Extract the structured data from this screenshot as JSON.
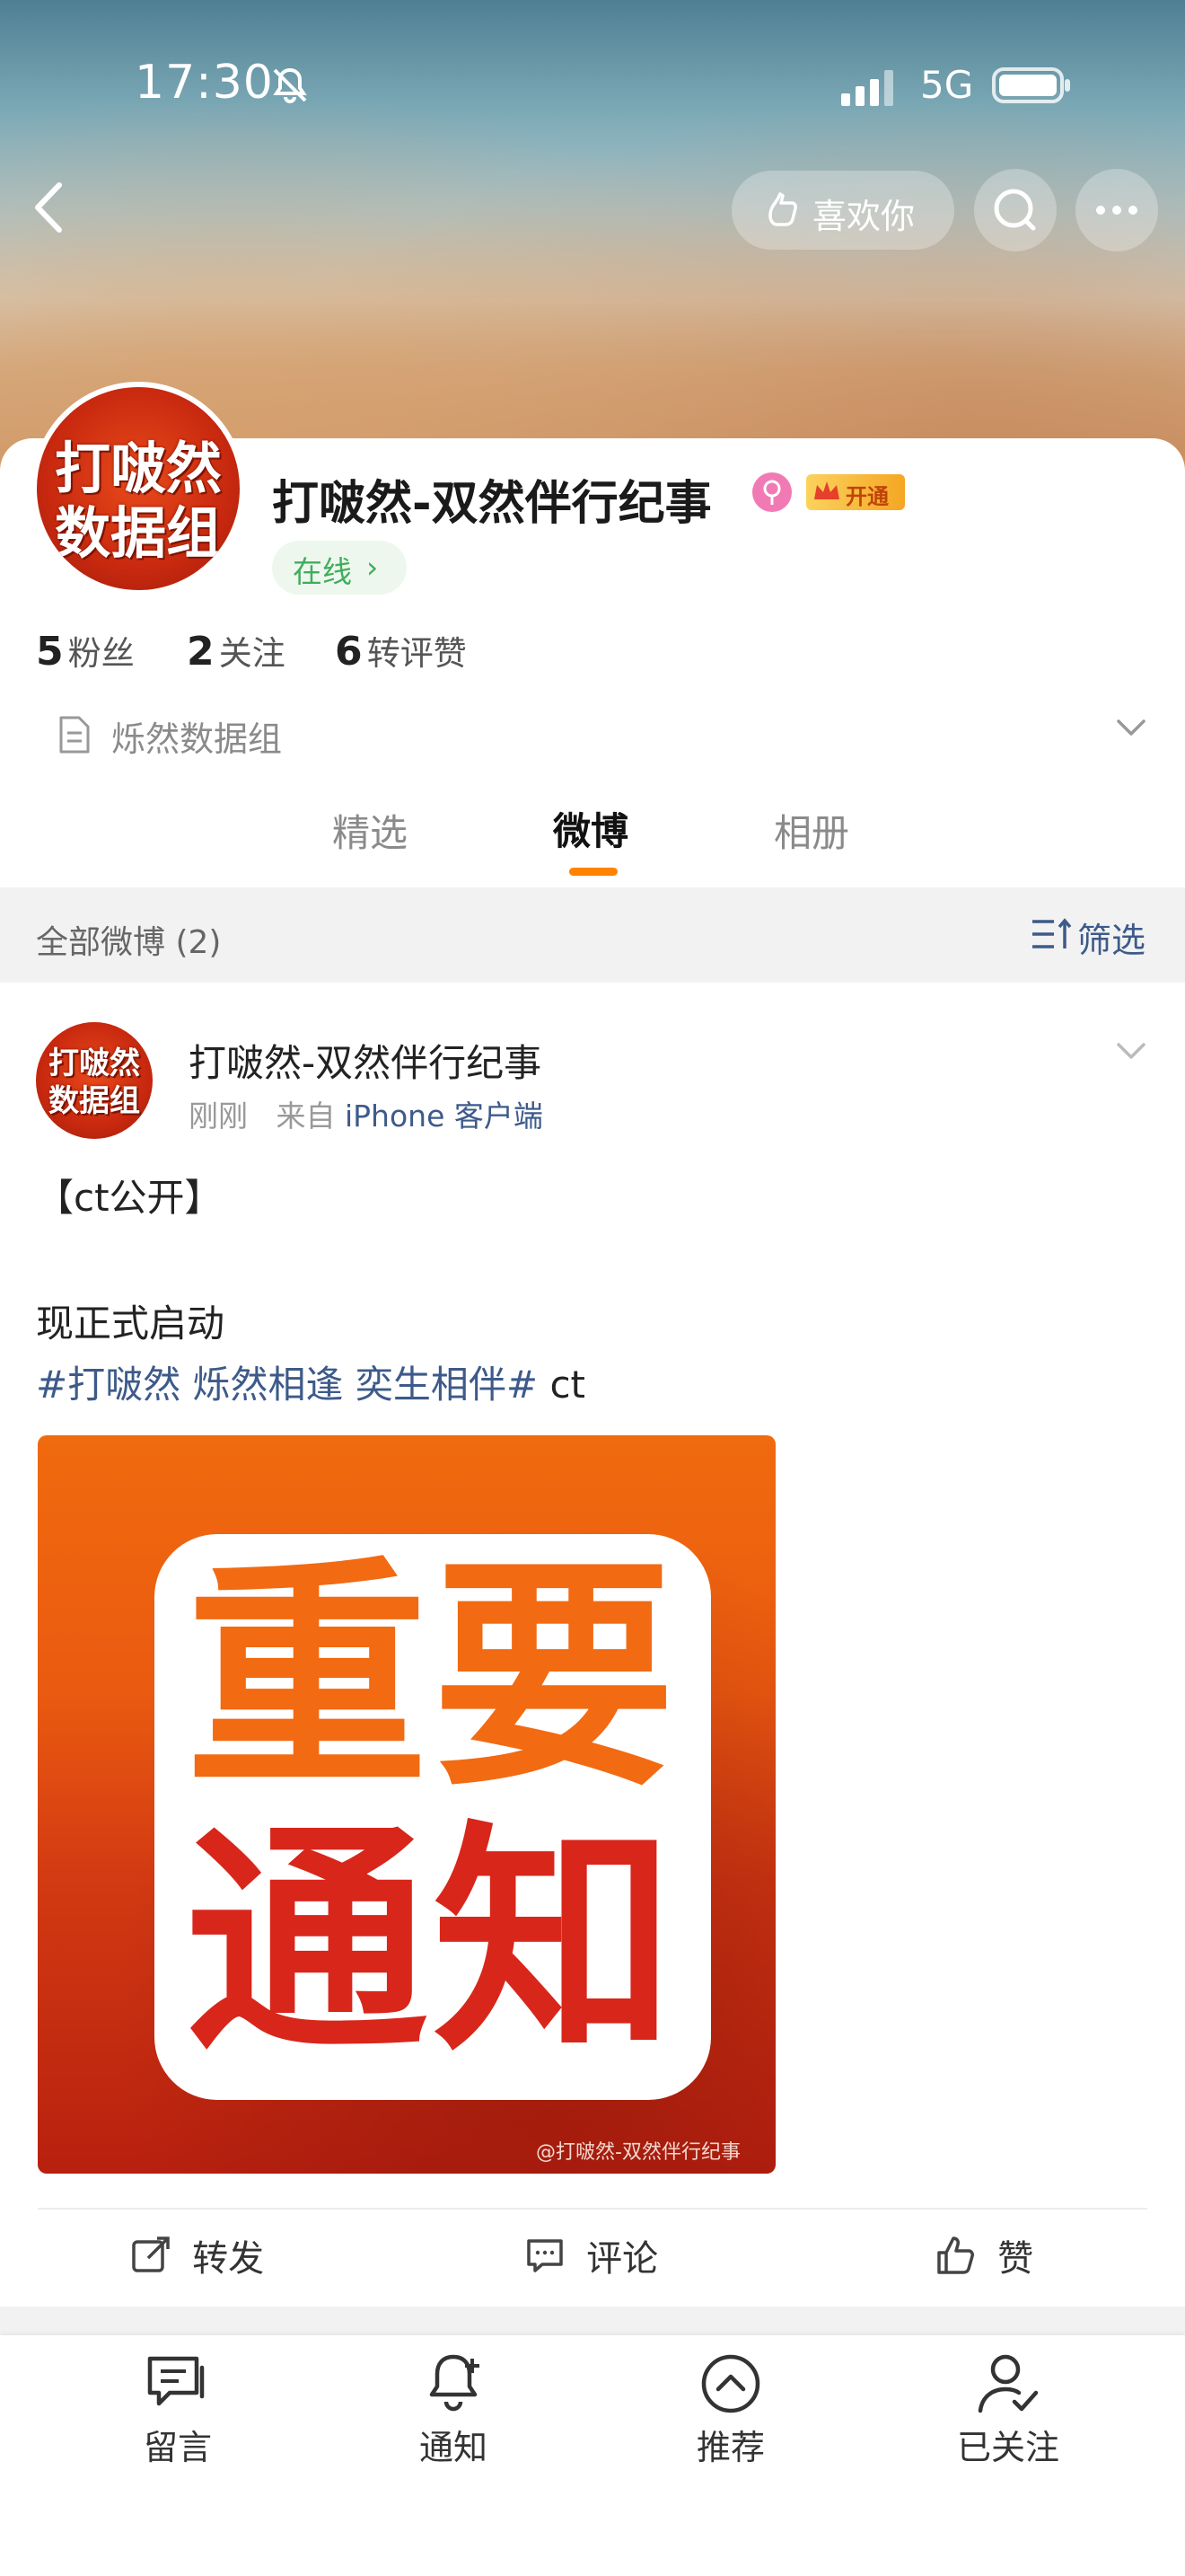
{
  "status_bar": {
    "time": "17:30",
    "network": "5G"
  },
  "header": {
    "like_label": "喜欢你"
  },
  "profile": {
    "name": "打啵然-双然伴行纪事",
    "avatar_text_line1": "打啵然",
    "avatar_text_line2": "数据组",
    "vip_label": "开通",
    "online_label": "在线",
    "stats": [
      {
        "num": "5",
        "label": "粉丝"
      },
      {
        "num": "2",
        "label": "关注"
      },
      {
        "num": "6",
        "label": "转评赞"
      }
    ],
    "group_name": "烁然数据组"
  },
  "tabs": [
    {
      "label": "精选"
    },
    {
      "label": "微博"
    },
    {
      "label": "相册"
    }
  ],
  "filter": {
    "left": "全部微博 (2)",
    "right": "筛选"
  },
  "post": {
    "author": "打啵然-双然伴行纪事",
    "time": "刚刚",
    "from_prefix": "来自",
    "source": "iPhone 客户端",
    "line1": "【ct公开】",
    "line2": "现正式启动",
    "topic": "#打啵然 烁然相逢 奕生相伴#",
    "topic_suffix": " ct",
    "image_chars": [
      "重",
      "要",
      "通",
      "知"
    ],
    "image_watermark": "@打啵然-双然伴行纪事",
    "actions": [
      {
        "label": "转发"
      },
      {
        "label": "评论"
      },
      {
        "label": "赞"
      }
    ]
  },
  "bottom_nav": [
    {
      "label": "留言",
      "icon": "message-icon"
    },
    {
      "label": "通知",
      "icon": "bell-plus-icon"
    },
    {
      "label": "推荐",
      "icon": "chevron-up-circle-icon"
    },
    {
      "label": "已关注",
      "icon": "user-check-icon"
    }
  ],
  "colors": {
    "accent": "#ff8200",
    "link": "#3d5a8a",
    "online": "#3fae5c"
  }
}
